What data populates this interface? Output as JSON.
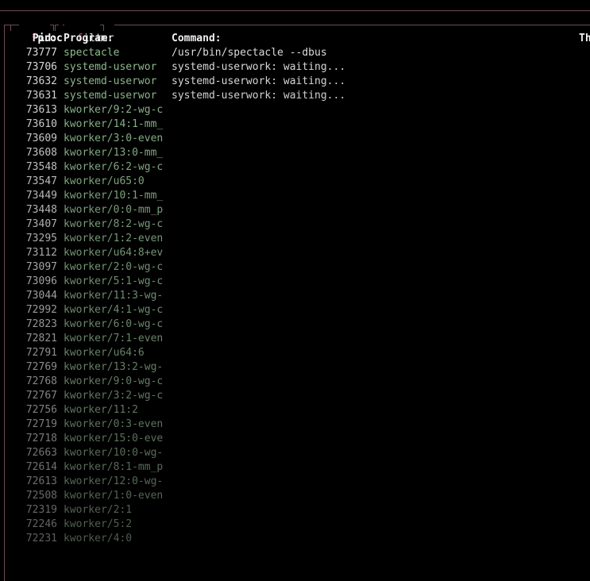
{
  "tabs": {
    "proc": {
      "hotkey": "*",
      "label": "proc"
    },
    "filter": {
      "hotkey": "f",
      "label": "ilter"
    }
  },
  "columns": {
    "pid": "Pid:",
    "program": "Program:",
    "command": "Command:",
    "threads": "Th"
  },
  "colors": {
    "border": "#6e4a54",
    "hotkey": "#e0506a",
    "program_bright": "#8fbc8f",
    "program_dim": "#5a6a5a"
  },
  "processes": [
    {
      "pid": "73777",
      "program": "spectacle",
      "command": "/usr/bin/spectacle --dbus"
    },
    {
      "pid": "73706",
      "program": "systemd-userwor",
      "command": "systemd-userwork: waiting..."
    },
    {
      "pid": "73632",
      "program": "systemd-userwor",
      "command": "systemd-userwork: waiting..."
    },
    {
      "pid": "73631",
      "program": "systemd-userwor",
      "command": "systemd-userwork: waiting..."
    },
    {
      "pid": "73613",
      "program": "kworker/9:2-wg-c",
      "command": ""
    },
    {
      "pid": "73610",
      "program": "kworker/14:1-mm_",
      "command": ""
    },
    {
      "pid": "73609",
      "program": "kworker/3:0-even",
      "command": ""
    },
    {
      "pid": "73608",
      "program": "kworker/13:0-mm_",
      "command": ""
    },
    {
      "pid": "73548",
      "program": "kworker/6:2-wg-c",
      "command": ""
    },
    {
      "pid": "73547",
      "program": "kworker/u65:0",
      "command": ""
    },
    {
      "pid": "73449",
      "program": "kworker/10:1-mm_",
      "command": ""
    },
    {
      "pid": "73448",
      "program": "kworker/0:0-mm_p",
      "command": ""
    },
    {
      "pid": "73407",
      "program": "kworker/8:2-wg-c",
      "command": ""
    },
    {
      "pid": "73295",
      "program": "kworker/1:2-even",
      "command": ""
    },
    {
      "pid": "73112",
      "program": "kworker/u64:8+ev",
      "command": ""
    },
    {
      "pid": "73097",
      "program": "kworker/2:0-wg-c",
      "command": ""
    },
    {
      "pid": "73096",
      "program": "kworker/5:1-wg-c",
      "command": ""
    },
    {
      "pid": "73044",
      "program": "kworker/11:3-wg-",
      "command": ""
    },
    {
      "pid": "72992",
      "program": "kworker/4:1-wg-c",
      "command": ""
    },
    {
      "pid": "72823",
      "program": "kworker/6:0-wg-c",
      "command": ""
    },
    {
      "pid": "72821",
      "program": "kworker/7:1-even",
      "command": ""
    },
    {
      "pid": "72791",
      "program": "kworker/u64:6",
      "command": ""
    },
    {
      "pid": "72769",
      "program": "kworker/13:2-wg-",
      "command": ""
    },
    {
      "pid": "72768",
      "program": "kworker/9:0-wg-c",
      "command": ""
    },
    {
      "pid": "72767",
      "program": "kworker/3:2-wg-c",
      "command": ""
    },
    {
      "pid": "72756",
      "program": "kworker/11:2",
      "command": ""
    },
    {
      "pid": "72719",
      "program": "kworker/0:3-even",
      "command": ""
    },
    {
      "pid": "72718",
      "program": "kworker/15:0-eve",
      "command": ""
    },
    {
      "pid": "72663",
      "program": "kworker/10:0-wg-",
      "command": ""
    },
    {
      "pid": "72614",
      "program": "kworker/8:1-mm_p",
      "command": ""
    },
    {
      "pid": "72613",
      "program": "kworker/12:0-wg-",
      "command": ""
    },
    {
      "pid": "72508",
      "program": "kworker/1:0-even",
      "command": ""
    },
    {
      "pid": "72319",
      "program": "kworker/2:1",
      "command": ""
    },
    {
      "pid": "72246",
      "program": "kworker/5:2",
      "command": ""
    },
    {
      "pid": "72231",
      "program": "kworker/4:0",
      "command": ""
    }
  ]
}
